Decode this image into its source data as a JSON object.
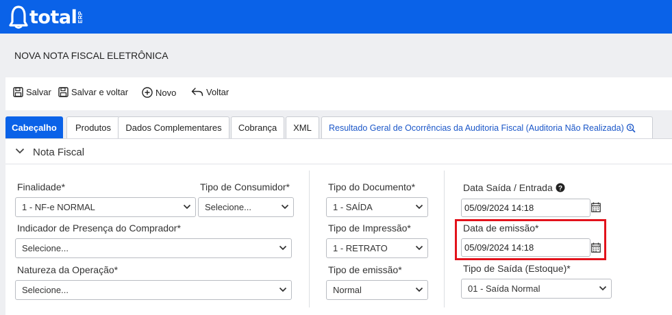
{
  "app": {
    "logo_word": "total",
    "logo_suffix": "ERP",
    "brand_color": "#0a62e8"
  },
  "page": {
    "title": "NOVA NOTA FISCAL ELETRÔNICA"
  },
  "toolbar": {
    "save": "Salvar",
    "save_back": "Salvar e voltar",
    "new": "Novo",
    "back": "Voltar"
  },
  "tabs": [
    {
      "label": "Cabeçalho",
      "active": true
    },
    {
      "label": "Produtos"
    },
    {
      "label": "Dados Complementares"
    },
    {
      "label": "Cobrança"
    },
    {
      "label": "XML"
    },
    {
      "label": "Resultado Geral de Ocorrências da Auditoria Fiscal (Auditoria Não Realizada)"
    }
  ],
  "section": {
    "title": "Nota Fiscal"
  },
  "form": {
    "finalidade": {
      "label": "Finalidade*",
      "value": "1 - NF-e NORMAL"
    },
    "tipo_consumidor": {
      "label": "Tipo de Consumidor*",
      "value": "Selecione..."
    },
    "indicador_presenca": {
      "label": "Indicador de Presença do Comprador*",
      "value": "Selecione..."
    },
    "natureza_operacao": {
      "label": "Natureza da Operação*",
      "value": "Selecione..."
    },
    "tipo_documento": {
      "label": "Tipo do Documento*",
      "value": "1 - SAÍDA"
    },
    "tipo_impressao": {
      "label": "Tipo de Impressão*",
      "value": "1 - RETRATO"
    },
    "tipo_emissao": {
      "label": "Tipo de emissão*",
      "value": "Normal"
    },
    "data_saida": {
      "label": "Data Saída / Entrada",
      "value": "05/09/2024 14:18"
    },
    "data_emissao": {
      "label": "Data de emissão*",
      "value": "05/09/2024 14:18"
    },
    "tipo_saida": {
      "label": "Tipo de Saída (Estoque)*",
      "value": "01 - Saída Normal"
    }
  }
}
